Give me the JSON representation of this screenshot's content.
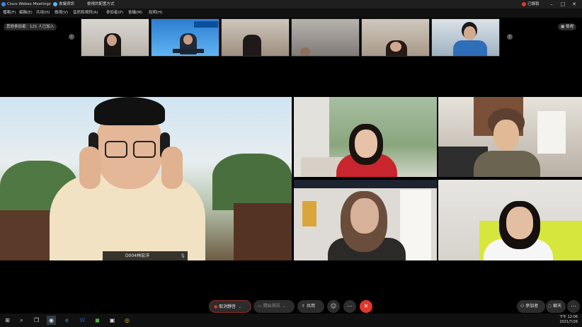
{
  "titlebar": {
    "app_title": "Cisco Webex Meetings",
    "tab2": "會議資訊",
    "tab3": "檢視的配置方式",
    "user_label": "已錄製"
  },
  "menu": [
    "檔案(F)",
    "編輯(E)",
    "共用(H)",
    "檢視(V)",
    "音訊和視訊(A)",
    "參加者(P)",
    "會議(M)",
    "說明(H)"
  ],
  "strip": {
    "participants_pill": "其他參加者：121 人已加入",
    "layout_label": "檢視"
  },
  "thumbnails": [
    {
      "label": "thumbnail-1"
    },
    {
      "label": "thumbnail-2"
    },
    {
      "label": "thumbnail-3"
    },
    {
      "label": "thumbnail-4"
    },
    {
      "label": "thumbnail-5"
    },
    {
      "label": "thumbnail-6"
    }
  ],
  "main_tile": {
    "name": "D004林宏洋"
  },
  "controls": {
    "mute": "取消靜音",
    "video": "開始視訊",
    "share": "共用",
    "participants": "參加者",
    "chat": "聊天"
  },
  "clock": {
    "time": "下午 12:06",
    "date": "2021/7/26"
  },
  "colors": {
    "end_button": "#e0382e",
    "accent": "#3b8ede"
  }
}
